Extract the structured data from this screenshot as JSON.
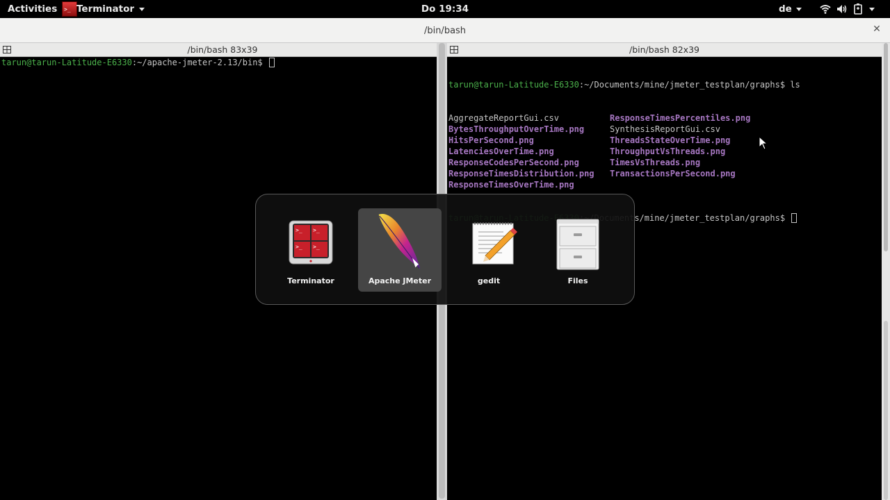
{
  "topbar": {
    "activities": "Activities",
    "app_menu": "Terminator",
    "clock": "Do 19:34",
    "language": "de"
  },
  "window": {
    "title": "/bin/bash"
  },
  "left_pane": {
    "title": "/bin/bash 83x39",
    "prompt_user": "tarun@tarun-Latitude-E6330",
    "prompt_path": ":~/apache-jmeter-2.13/bin$ "
  },
  "right_pane": {
    "title": "/bin/bash 82x39",
    "prompt_user": "tarun@tarun-Latitude-E6330",
    "prompt_path_cmd": ":~/Documents/mine/jmeter_testplan/graphs$ ls",
    "prompt_path": ":~/Documents/mine/jmeter_testplan/graphs$ ",
    "ls_col1": [
      "AggregateReportGui.csv",
      "BytesThroughputOverTime.png",
      "HitsPerSecond.png",
      "LatenciesOverTime.png",
      "ResponseCodesPerSecond.png",
      "ResponseTimesDistribution.png",
      "ResponseTimesOverTime.png"
    ],
    "ls_col2": [
      "ResponseTimesPercentiles.png",
      "SynthesisReportGui.csv",
      "ThreadsStateOverTime.png",
      "ThroughputVsThreads.png",
      "TimesVsThreads.png",
      "TransactionsPerSecond.png",
      ""
    ]
  },
  "switcher": {
    "items": [
      {
        "label": "Terminator",
        "icon": "terminator-icon"
      },
      {
        "label": "Apache JMeter",
        "icon": "jmeter-feather-icon"
      },
      {
        "label": "gedit",
        "icon": "gedit-icon"
      },
      {
        "label": "Files",
        "icon": "files-cabinet-icon"
      }
    ],
    "selected_index": 1
  },
  "colors": {
    "prompt_green": "#4bb14b",
    "png_purple": "#a777c2",
    "text_gray": "#c6c6c6"
  }
}
